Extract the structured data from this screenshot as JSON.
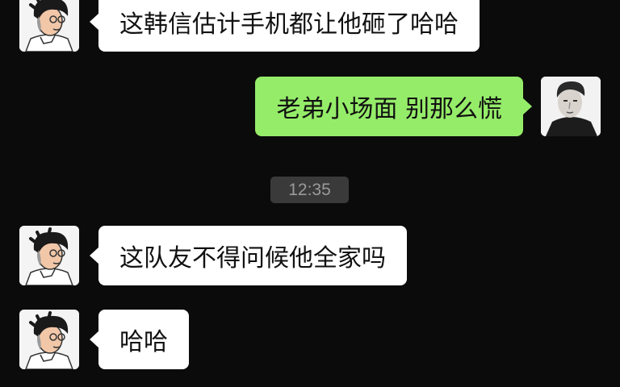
{
  "messages": [
    {
      "sender": "other",
      "text": "这韩信估计手机都让他砸了哈哈",
      "avatar_icon": "cartoon-man-avatar-icon"
    },
    {
      "sender": "self",
      "text": "老弟小场面 别那么慌",
      "avatar_icon": "man-photo-avatar-icon"
    },
    {
      "sender": "other",
      "text": "这队友不得问候他全家吗",
      "avatar_icon": "cartoon-man-avatar-icon"
    },
    {
      "sender": "other",
      "text": "哈哈",
      "avatar_icon": "cartoon-man-avatar-icon"
    }
  ],
  "timestamp": "12:35",
  "colors": {
    "background": "#0b0b0b",
    "incoming_bubble": "#ffffff",
    "outgoing_bubble": "#95ec69",
    "timestamp_bg": "#3a3a3a"
  }
}
